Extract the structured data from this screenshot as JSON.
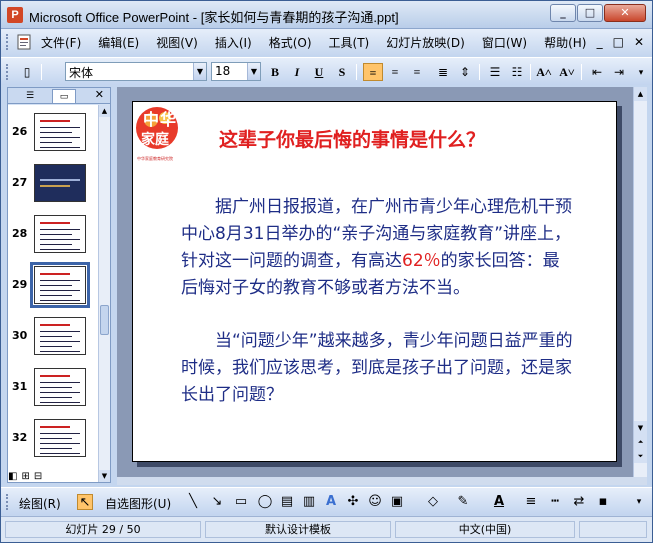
{
  "window": {
    "title": "Microsoft Office PowerPoint - [家长如何与青春期的孩子沟通.ppt]",
    "controls": [
      "0",
      "□",
      "×"
    ]
  },
  "menu": {
    "items": [
      "文件(F)",
      "编辑(E)",
      "视图(V)",
      "插入(I)",
      "格式(O)",
      "工具(T)",
      "幻灯片放映(D)",
      "窗口(W)",
      "帮助(H)"
    ],
    "doc_controls": [
      "_",
      "□",
      "×"
    ]
  },
  "format_toolbar": {
    "font_name": "宋体",
    "font_size": "18",
    "bold": "B",
    "italic": "I",
    "underline": "U",
    "shadow": "S"
  },
  "thumbnails": [
    {
      "num": "26",
      "style": "light"
    },
    {
      "num": "27",
      "style": "dark"
    },
    {
      "num": "28",
      "style": "light"
    },
    {
      "num": "29",
      "style": "light",
      "selected": true
    },
    {
      "num": "30",
      "style": "light"
    },
    {
      "num": "31",
      "style": "light"
    },
    {
      "num": "32",
      "style": "light"
    }
  ],
  "slide": {
    "logo_text": "中华家庭",
    "logo_caption": "中华家庭教育研究院",
    "title": "这辈子你最后悔的事情是什么？",
    "paragraph1_a": "据广州日报报道，在广州市青少年心理危机干预中心8月31日举办的“亲子沟通与家庭教育”讲座上，针对这一问题的调查，有高达",
    "paragraph1_highlight": "62％",
    "paragraph1_b": "的家长回答：最后悔对子女的教育不够或者方法不当。",
    "paragraph2": "当“问题少年”越来越多，青少年问题日益严重的时候，我们应该思考，到底是孩子出了问题，还是家长出了问题？"
  },
  "draw_toolbar": {
    "draw_label": "绘图(R)",
    "autoshapes_label": "自选图形(U)"
  },
  "status": {
    "slide_info": "幻灯片 29 / 50",
    "template": "默认设计模板",
    "language": "中文(中国)"
  },
  "colors": {
    "title_red": "#e02020",
    "body_blue": "#1e2d86",
    "accent_orange": "#ffc46a"
  }
}
